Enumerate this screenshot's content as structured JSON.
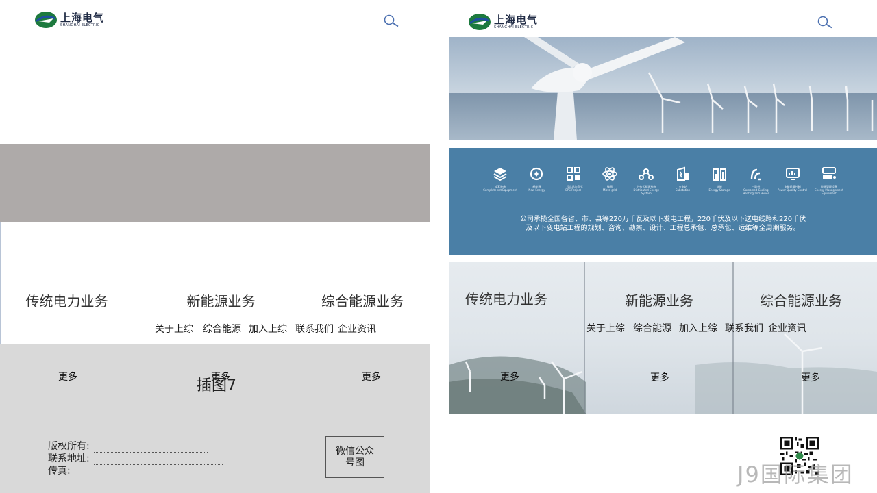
{
  "left": {
    "logo": {
      "cn": "上海电气",
      "en": "SHANGHAI ELECTRIC"
    },
    "cards": [
      {
        "title": "传统电力业务",
        "more": "更多"
      },
      {
        "title": "新能源业务",
        "more": "更多"
      },
      {
        "title": "综合能源业务",
        "more": "更多"
      }
    ],
    "nav": [
      "关于上综",
      "综合能源",
      "加入上综",
      "联系我们",
      "企业资讯"
    ],
    "placeholder": "插图7",
    "footer": {
      "copyright": "版权所有:",
      "address": "联系地址:",
      "fax": "传真:"
    },
    "wechat": "微信公众号图"
  },
  "right": {
    "logo": {
      "cn": "上海电气",
      "en": "SHANGHAI ELECTRIC"
    },
    "services": [
      {
        "icon": "layers-icon",
        "cn": "成套装备",
        "en": "Complete-set Equipment"
      },
      {
        "icon": "recycle-icon",
        "cn": "新能源",
        "en": "New Energy"
      },
      {
        "icon": "grid-icon",
        "cn": "工程总承包EPC",
        "en": "EPC Project"
      },
      {
        "icon": "atom-icon",
        "cn": "微网",
        "en": "Micro-grid"
      },
      {
        "icon": "network-icon",
        "cn": "分布式能源系统",
        "en": "Distributed Energy System"
      },
      {
        "icon": "substation-icon",
        "cn": "变电站",
        "en": "Substation"
      },
      {
        "icon": "battery-icon",
        "cn": "储能",
        "en": "Energy Storage"
      },
      {
        "icon": "power-icon",
        "cn": "三联供",
        "en": "Combined Cooling Heating and Power"
      },
      {
        "icon": "monitor-icon",
        "cn": "电能质量控制",
        "en": "Power Quality Control"
      },
      {
        "icon": "device-icon",
        "cn": "能源管理设备",
        "en": "Energy Management Equipment"
      }
    ],
    "intro_line1": "公司承揽全国各省、市、县等220万千瓦及以下发电工程，220千伏及以下送电线路和220千伏",
    "intro_line2": "及以下变电站工程的规划、咨询、勘察、设计、工程总承包、总承包、运维等全周期服务。",
    "cards": [
      {
        "title": "传统电力业务",
        "more": "更多"
      },
      {
        "title": "新能源业务",
        "more": "更多"
      },
      {
        "title": "综合能源业务",
        "more": "更多"
      }
    ],
    "nav": [
      "关于上综",
      "综合能源",
      "加入上综",
      "联系我们",
      "企业资讯"
    ],
    "watermark": "J9国际集团"
  },
  "colors": {
    "accent_blue": "#4a7fa6",
    "banner_gray": "#aeaaa9",
    "footer_gray": "#d9d9d9"
  }
}
